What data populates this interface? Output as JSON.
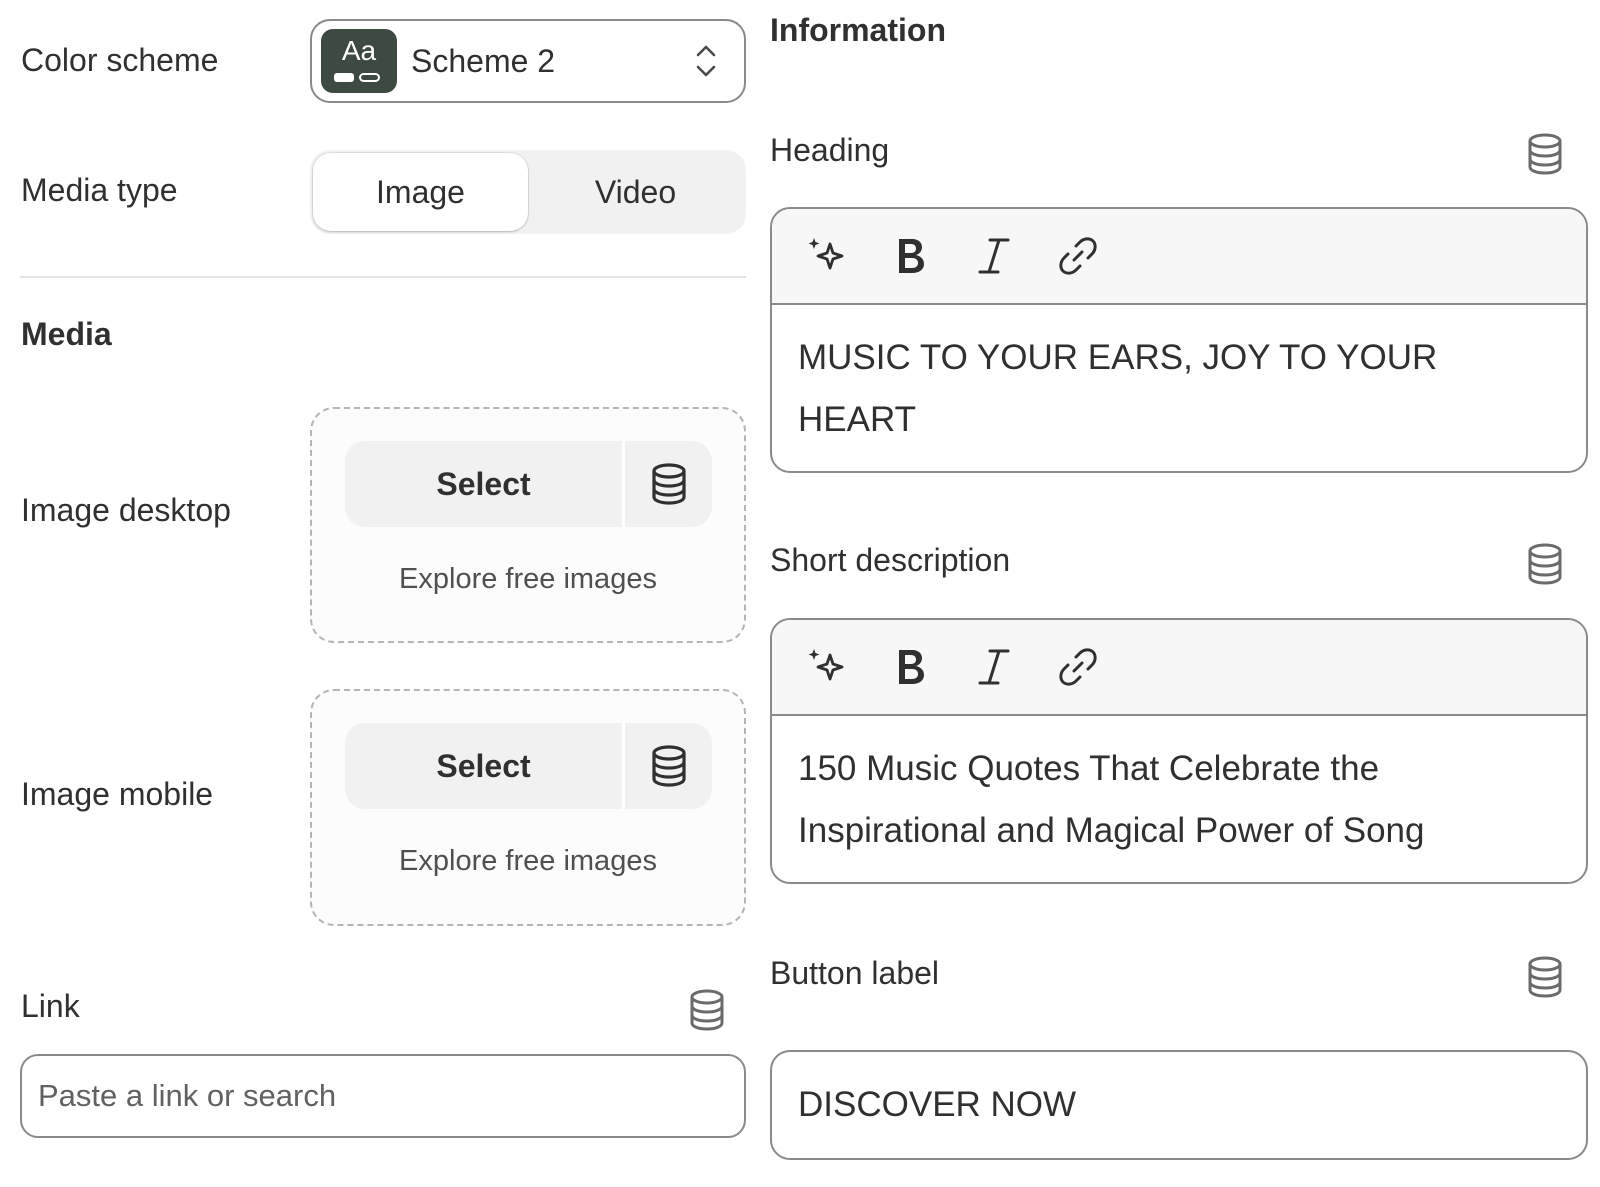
{
  "color_scheme": {
    "label": "Color scheme",
    "value": "Scheme 2",
    "swatch_text": "Aa",
    "swatch_color": "#3d4a42"
  },
  "media_type": {
    "label": "Media type",
    "options": [
      "Image",
      "Video"
    ],
    "selected": "Image"
  },
  "media": {
    "heading": "Media",
    "image_desktop": {
      "label": "Image desktop",
      "select_label": "Select",
      "explore_label": "Explore free images"
    },
    "image_mobile": {
      "label": "Image mobile",
      "select_label": "Select",
      "explore_label": "Explore free images"
    }
  },
  "link": {
    "label": "Link",
    "placeholder": "Paste a link or search",
    "value": ""
  },
  "information": {
    "heading": "Information",
    "heading_field": {
      "label": "Heading",
      "content": "MUSIC TO YOUR EARS, JOY TO YOUR HEART"
    },
    "short_description": {
      "label": "Short description",
      "content": "150 Music Quotes That Celebrate the Inspirational and Magical Power of Song"
    },
    "button_label": {
      "label": "Button label",
      "value": "DISCOVER NOW"
    }
  },
  "icons": [
    "sparkle-icon",
    "bold-icon",
    "italic-icon",
    "link-icon",
    "dynamic-source-icon",
    "select-arrows-icon"
  ]
}
